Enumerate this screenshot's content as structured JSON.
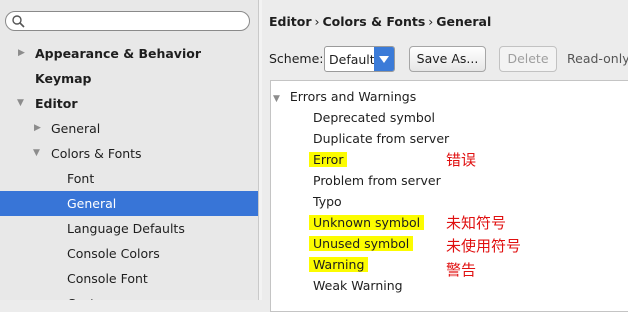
{
  "search": {
    "placeholder": "",
    "icon": "search-icon"
  },
  "sidebar": {
    "items": [
      {
        "label": "Appearance & Behavior",
        "expanded": false
      },
      {
        "label": "Keymap"
      },
      {
        "label": "Editor",
        "expanded": true
      },
      {
        "label": "General",
        "expanded": false
      },
      {
        "label": "Colors & Fonts",
        "expanded": true
      },
      {
        "label": "Font"
      },
      {
        "label": "General",
        "selected": true
      },
      {
        "label": "Language Defaults"
      },
      {
        "label": "Console Colors"
      },
      {
        "label": "Console Font"
      },
      {
        "label": "Custom"
      }
    ]
  },
  "breadcrumb": {
    "part1": "Editor",
    "part2": "Colors & Fonts",
    "part3": "General",
    "separator": "›"
  },
  "scheme": {
    "label": "Scheme:",
    "value": "Default"
  },
  "buttons": {
    "save_as": "Save As...",
    "delete": "Delete"
  },
  "readonly_label": "Read-only",
  "list": {
    "group": "Errors and Warnings",
    "items": [
      {
        "label": "Deprecated symbol",
        "highlighted": false
      },
      {
        "label": "Duplicate from server",
        "highlighted": false
      },
      {
        "label": "Error",
        "highlighted": true,
        "note": "错误"
      },
      {
        "label": "Problem from server",
        "highlighted": false
      },
      {
        "label": "Typo",
        "highlighted": false
      },
      {
        "label": "Unknown symbol",
        "highlighted": true,
        "note": "未知符号"
      },
      {
        "label": "Unused symbol",
        "highlighted": true,
        "note": "未使用符号"
      },
      {
        "label": "Warning",
        "highlighted": true,
        "note": "警告"
      },
      {
        "label": "Weak Warning",
        "highlighted": false
      }
    ]
  },
  "colors": {
    "selection": "#3875d7",
    "highlight": "#fcfc00",
    "annotation": "#e01010",
    "dropdown_accent": "#3b7bd8"
  }
}
